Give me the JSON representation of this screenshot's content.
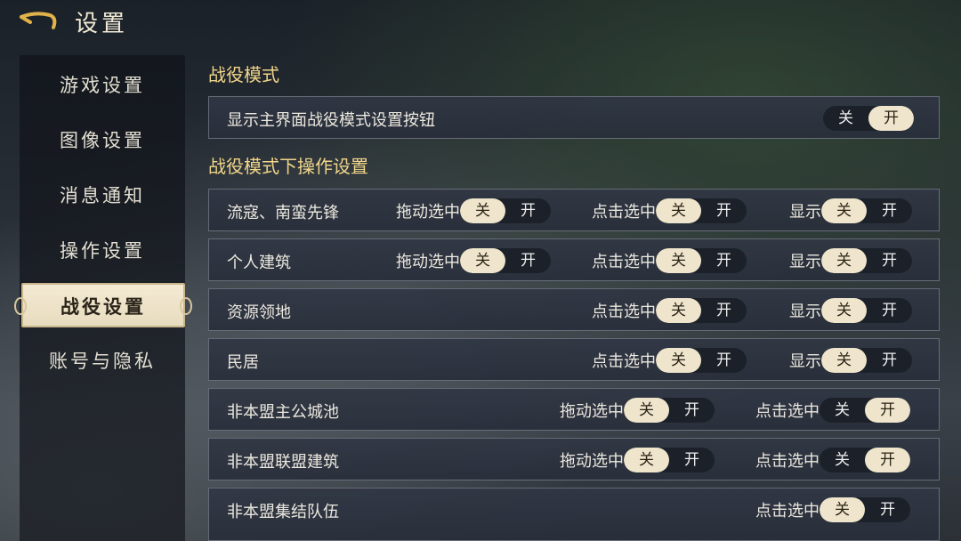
{
  "header": {
    "title": "设置"
  },
  "sidebar": {
    "items": [
      {
        "label": "游戏设置"
      },
      {
        "label": "图像设置"
      },
      {
        "label": "消息通知"
      },
      {
        "label": "操作设置"
      },
      {
        "label": "战役设置"
      },
      {
        "label": "账号与隐私"
      }
    ],
    "active_index": 4
  },
  "sections": {
    "campaign_mode": {
      "title": "战役模式",
      "rows": [
        {
          "label": "显示主界面战役模式设置按钮",
          "toggle": {
            "off": "关",
            "on": "开",
            "selected": "开"
          }
        }
      ]
    },
    "campaign_ops": {
      "title": "战役模式下操作设置",
      "rows": [
        {
          "label": "流寇、南蛮先锋",
          "drag": {
            "label": "拖动选中",
            "off": "关",
            "on": "开",
            "selected": "关"
          },
          "click": {
            "label": "点击选中",
            "off": "关",
            "on": "开",
            "selected": "关"
          },
          "show": {
            "label": "显示",
            "off": "关",
            "on": "开",
            "selected": "关"
          }
        },
        {
          "label": "个人建筑",
          "drag": {
            "label": "拖动选中",
            "off": "关",
            "on": "开",
            "selected": "关"
          },
          "click": {
            "label": "点击选中",
            "off": "关",
            "on": "开",
            "selected": "关"
          },
          "show": {
            "label": "显示",
            "off": "关",
            "on": "开",
            "selected": "关"
          }
        },
        {
          "label": "资源领地",
          "click": {
            "label": "点击选中",
            "off": "关",
            "on": "开",
            "selected": "关"
          },
          "show": {
            "label": "显示",
            "off": "关",
            "on": "开",
            "selected": "关"
          }
        },
        {
          "label": "民居",
          "click": {
            "label": "点击选中",
            "off": "关",
            "on": "开",
            "selected": "关"
          },
          "show": {
            "label": "显示",
            "off": "关",
            "on": "开",
            "selected": "关"
          }
        },
        {
          "label": "非本盟主公城池",
          "drag": {
            "label": "拖动选中",
            "off": "关",
            "on": "开",
            "selected": "关"
          },
          "click": {
            "label": "点击选中",
            "off": "关",
            "on": "开",
            "selected": "开"
          }
        },
        {
          "label": "非本盟联盟建筑",
          "drag": {
            "label": "拖动选中",
            "off": "关",
            "on": "开",
            "selected": "关"
          },
          "click": {
            "label": "点击选中",
            "off": "关",
            "on": "开",
            "selected": "开"
          }
        },
        {
          "label": "非本盟集结队伍",
          "click": {
            "label": "点击选中",
            "off": "关",
            "on": "开",
            "selected": "关"
          }
        }
      ]
    }
  },
  "colors": {
    "accent": "#f0d58a",
    "toggle_on": "#efe5cc",
    "toggle_track": "#1c2129"
  },
  "icons": {
    "back": "back-arrow-icon"
  }
}
